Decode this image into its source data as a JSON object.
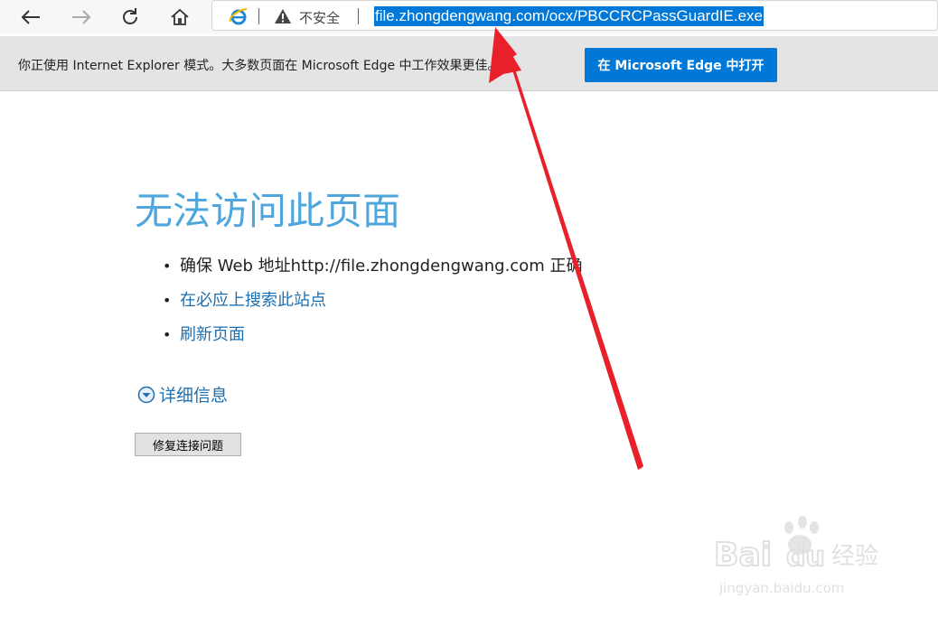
{
  "toolbar": {
    "back_icon": "arrow-left-icon",
    "forward_icon": "arrow-right-icon",
    "refresh_icon": "refresh-icon",
    "home_icon": "home-icon"
  },
  "address_bar": {
    "security_label": "不安全",
    "url": "file.zhongdengwang.com/ocx/PBCCRCPassGuardIE.exe"
  },
  "infobar": {
    "message": "你正使用 Internet Explorer 模式。大多数页面在 Microsoft Edge 中工作效果更佳。",
    "button_label": "在 Microsoft Edge 中打开"
  },
  "error_page": {
    "title": "无法访问此页面",
    "suggestions": [
      {
        "text": "确保 Web 地址http://file.zhongdengwang.com 正确"
      },
      {
        "text": "在必应上搜索此站点"
      },
      {
        "text": "刷新页面"
      }
    ],
    "details_label": "详细信息",
    "fix_button_label": "修复连接问题"
  },
  "watermark": {
    "brand": "Bai du 经验",
    "domain": "jingyan.baidu.com"
  },
  "colors": {
    "accent_blue": "#0078d7",
    "title_blue": "#4ea6dc",
    "link_blue": "#1e6fb0",
    "annotation_red": "#e8202a"
  }
}
